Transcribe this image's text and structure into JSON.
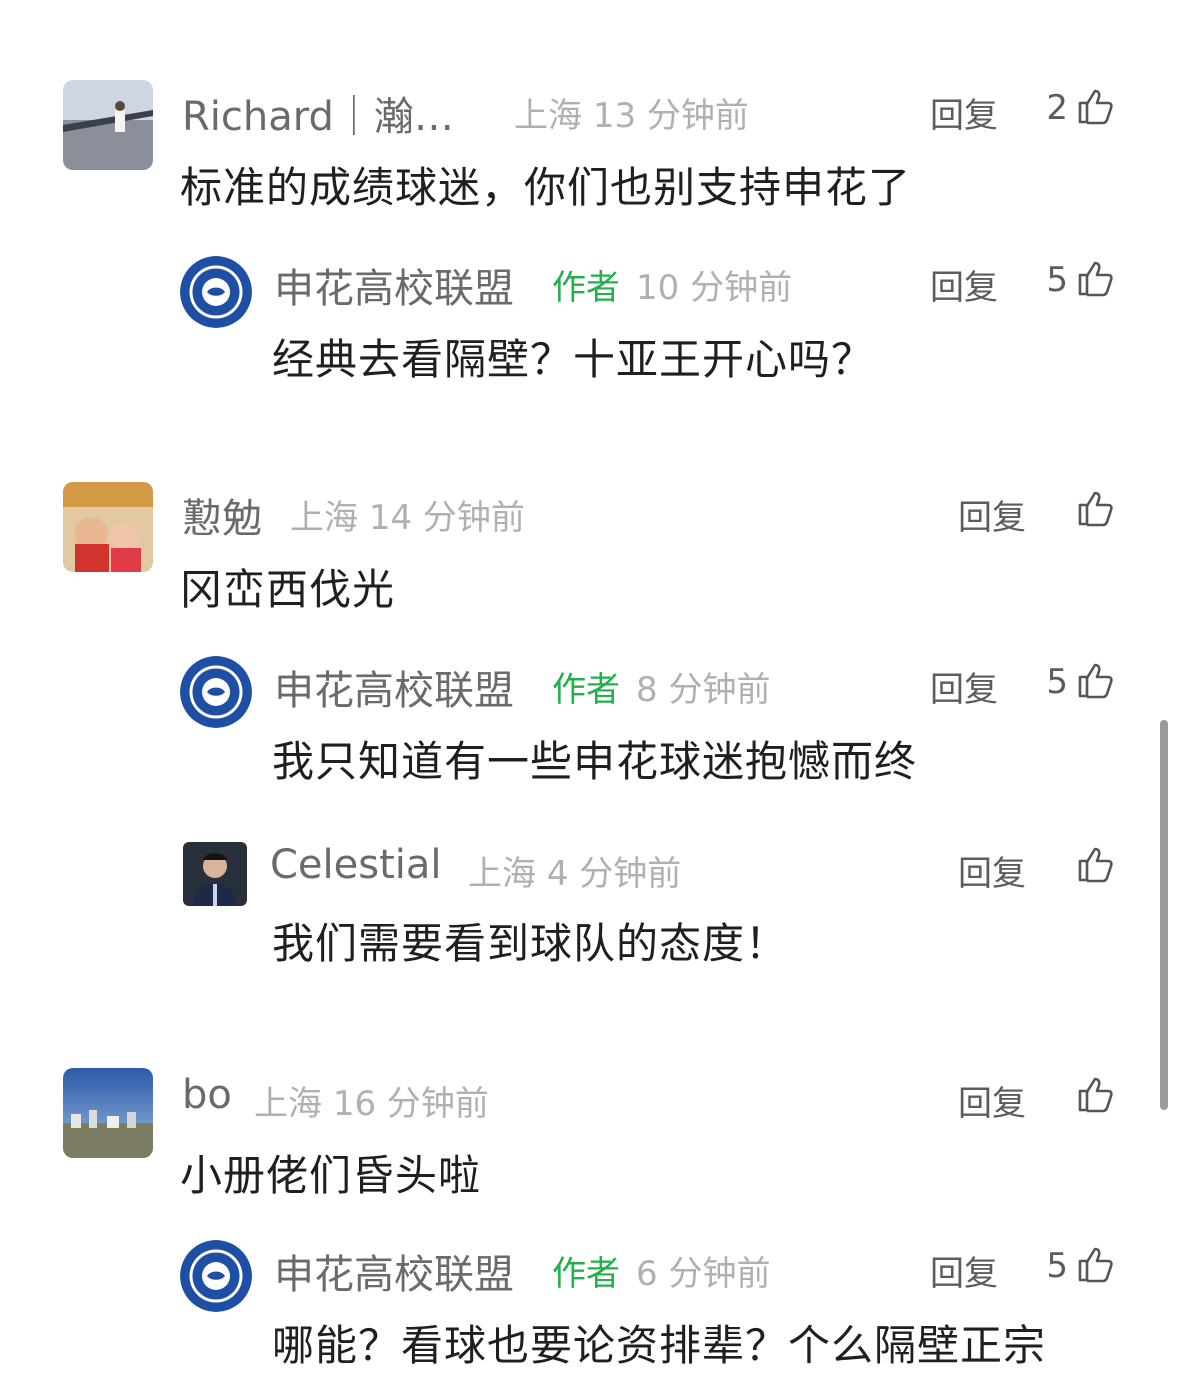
{
  "reply_label": "回复",
  "author_tag": "作者",
  "colors": {
    "author_tag": "#21b04b",
    "meta": "#b0b0b0",
    "name": "#6a6a6a",
    "text": "#1f1f1f"
  },
  "comments": [
    {
      "name": "Richard｜瀚…",
      "location": "上海",
      "time": "13 分钟前",
      "likes": "2",
      "text": "标准的成绩球迷，你们也别支持申花了"
    },
    {
      "name": "申花高校联盟",
      "time": "10 分钟前",
      "likes": "5",
      "text": "经典去看隔壁？十亚王开心吗？"
    },
    {
      "name": "懃勉",
      "location": "上海",
      "time": "14 分钟前",
      "likes": "",
      "text": "冈峦西伐光"
    },
    {
      "name": "申花高校联盟",
      "time": "8 分钟前",
      "likes": "5",
      "text": "我只知道有一些申花球迷抱憾而终"
    },
    {
      "name": "Celestial",
      "location": "上海",
      "time": "4 分钟前",
      "likes": "",
      "text": "我们需要看到球队的态度！"
    },
    {
      "name": "bo",
      "location": "上海",
      "time": "16 分钟前",
      "likes": "",
      "text": "小册佬们昏头啦"
    },
    {
      "name": "申花高校联盟",
      "time": "6 分钟前",
      "likes": "5",
      "text": "哪能？看球也要论资排辈？个么隔壁正宗"
    }
  ]
}
